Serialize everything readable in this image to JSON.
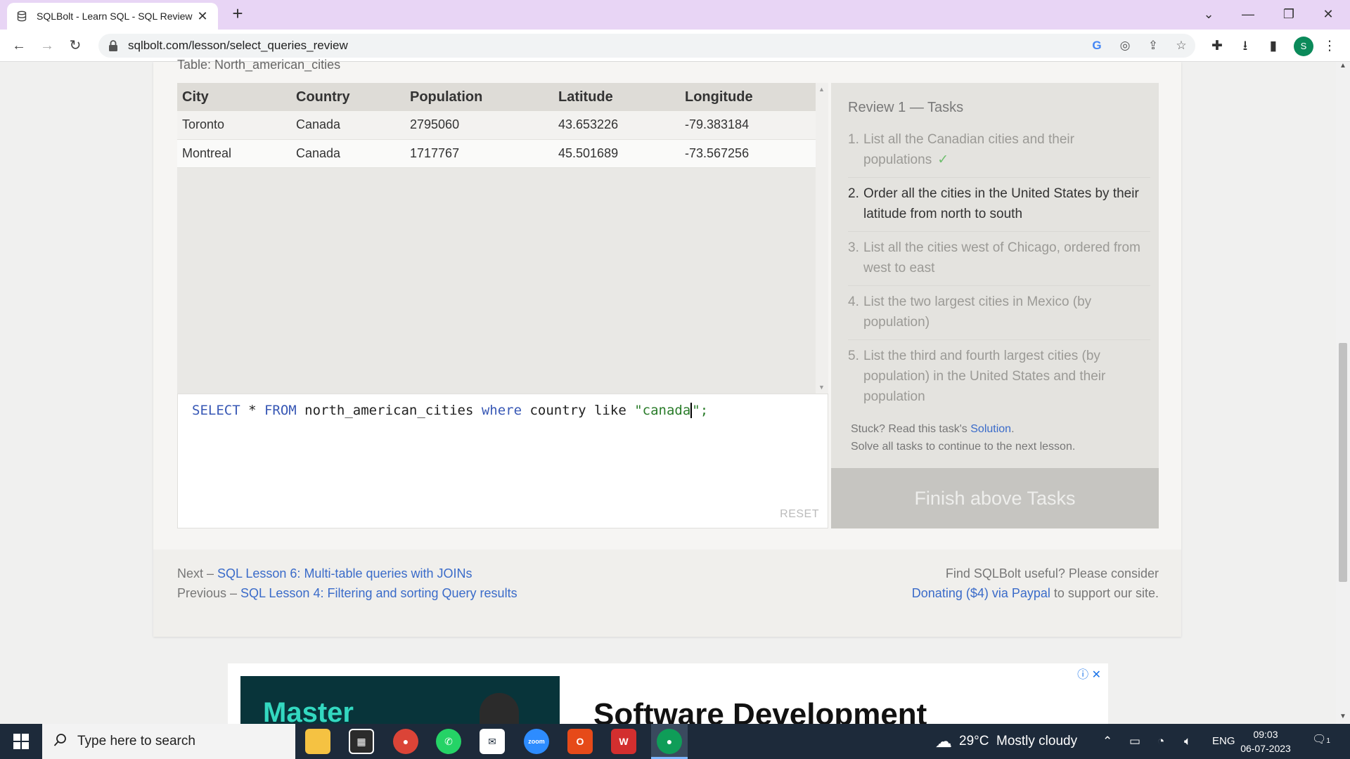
{
  "browser": {
    "tab_title": "SQLBolt - Learn SQL - SQL Review",
    "url": "sqlbolt.com/lesson/select_queries_review",
    "profile_initial": "S"
  },
  "lesson": {
    "table_caption": "Table: North_american_cities",
    "columns": [
      "City",
      "Country",
      "Population",
      "Latitude",
      "Longitude"
    ],
    "rows": [
      [
        "Toronto",
        "Canada",
        "2795060",
        "43.653226",
        "-79.383184"
      ],
      [
        "Montreal",
        "Canada",
        "1717767",
        "45.501689",
        "-73.567256"
      ]
    ],
    "query": {
      "part1": "SELECT",
      "part2": " * ",
      "part3": "FROM",
      "part4": " north_american_cities ",
      "part5": "where",
      "part6": " country like ",
      "part7": "\"canada",
      "part8": "\";"
    },
    "reset_label": "RESET"
  },
  "tasks": {
    "heading": "Review 1 — Tasks",
    "items": [
      {
        "num": "1.",
        "text": "List all the Canadian cities and their populations",
        "check": "✓"
      },
      {
        "num": "2.",
        "text": "Order all the cities in the United States by their latitude from north to south"
      },
      {
        "num": "3.",
        "text": "List all the cities west of Chicago, ordered from west to east"
      },
      {
        "num": "4.",
        "text": "List the two largest cities in Mexico (by population)"
      },
      {
        "num": "5.",
        "text": "List the third and fourth largest cities (by population) in the United States and their population"
      }
    ],
    "stuck_prefix": "Stuck? Read this task's ",
    "stuck_link": "Solution",
    "stuck_suffix": ".",
    "solve_all": "Solve all tasks to continue to the next lesson.",
    "finish_label": "Finish above Tasks"
  },
  "footer": {
    "next_prefix": "Next – ",
    "next_link": "SQL Lesson 6: Multi-table queries with JOINs",
    "prev_prefix": "Previous – ",
    "prev_link": "SQL Lesson 4: Filtering and sorting Query results",
    "donate_line1": "Find SQLBolt useful? Please consider",
    "donate_link": "Donating ($4) via Paypal",
    "donate_suffix": " to support our site."
  },
  "ad": {
    "image_text": "Master",
    "headline": "Software Development"
  },
  "taskbar": {
    "search_placeholder": "Type here to search",
    "weather": "29°C  Mostly cloudy",
    "lang": "ENG",
    "time": "09:03",
    "date": "06-07-2023",
    "notif_count": "1"
  }
}
